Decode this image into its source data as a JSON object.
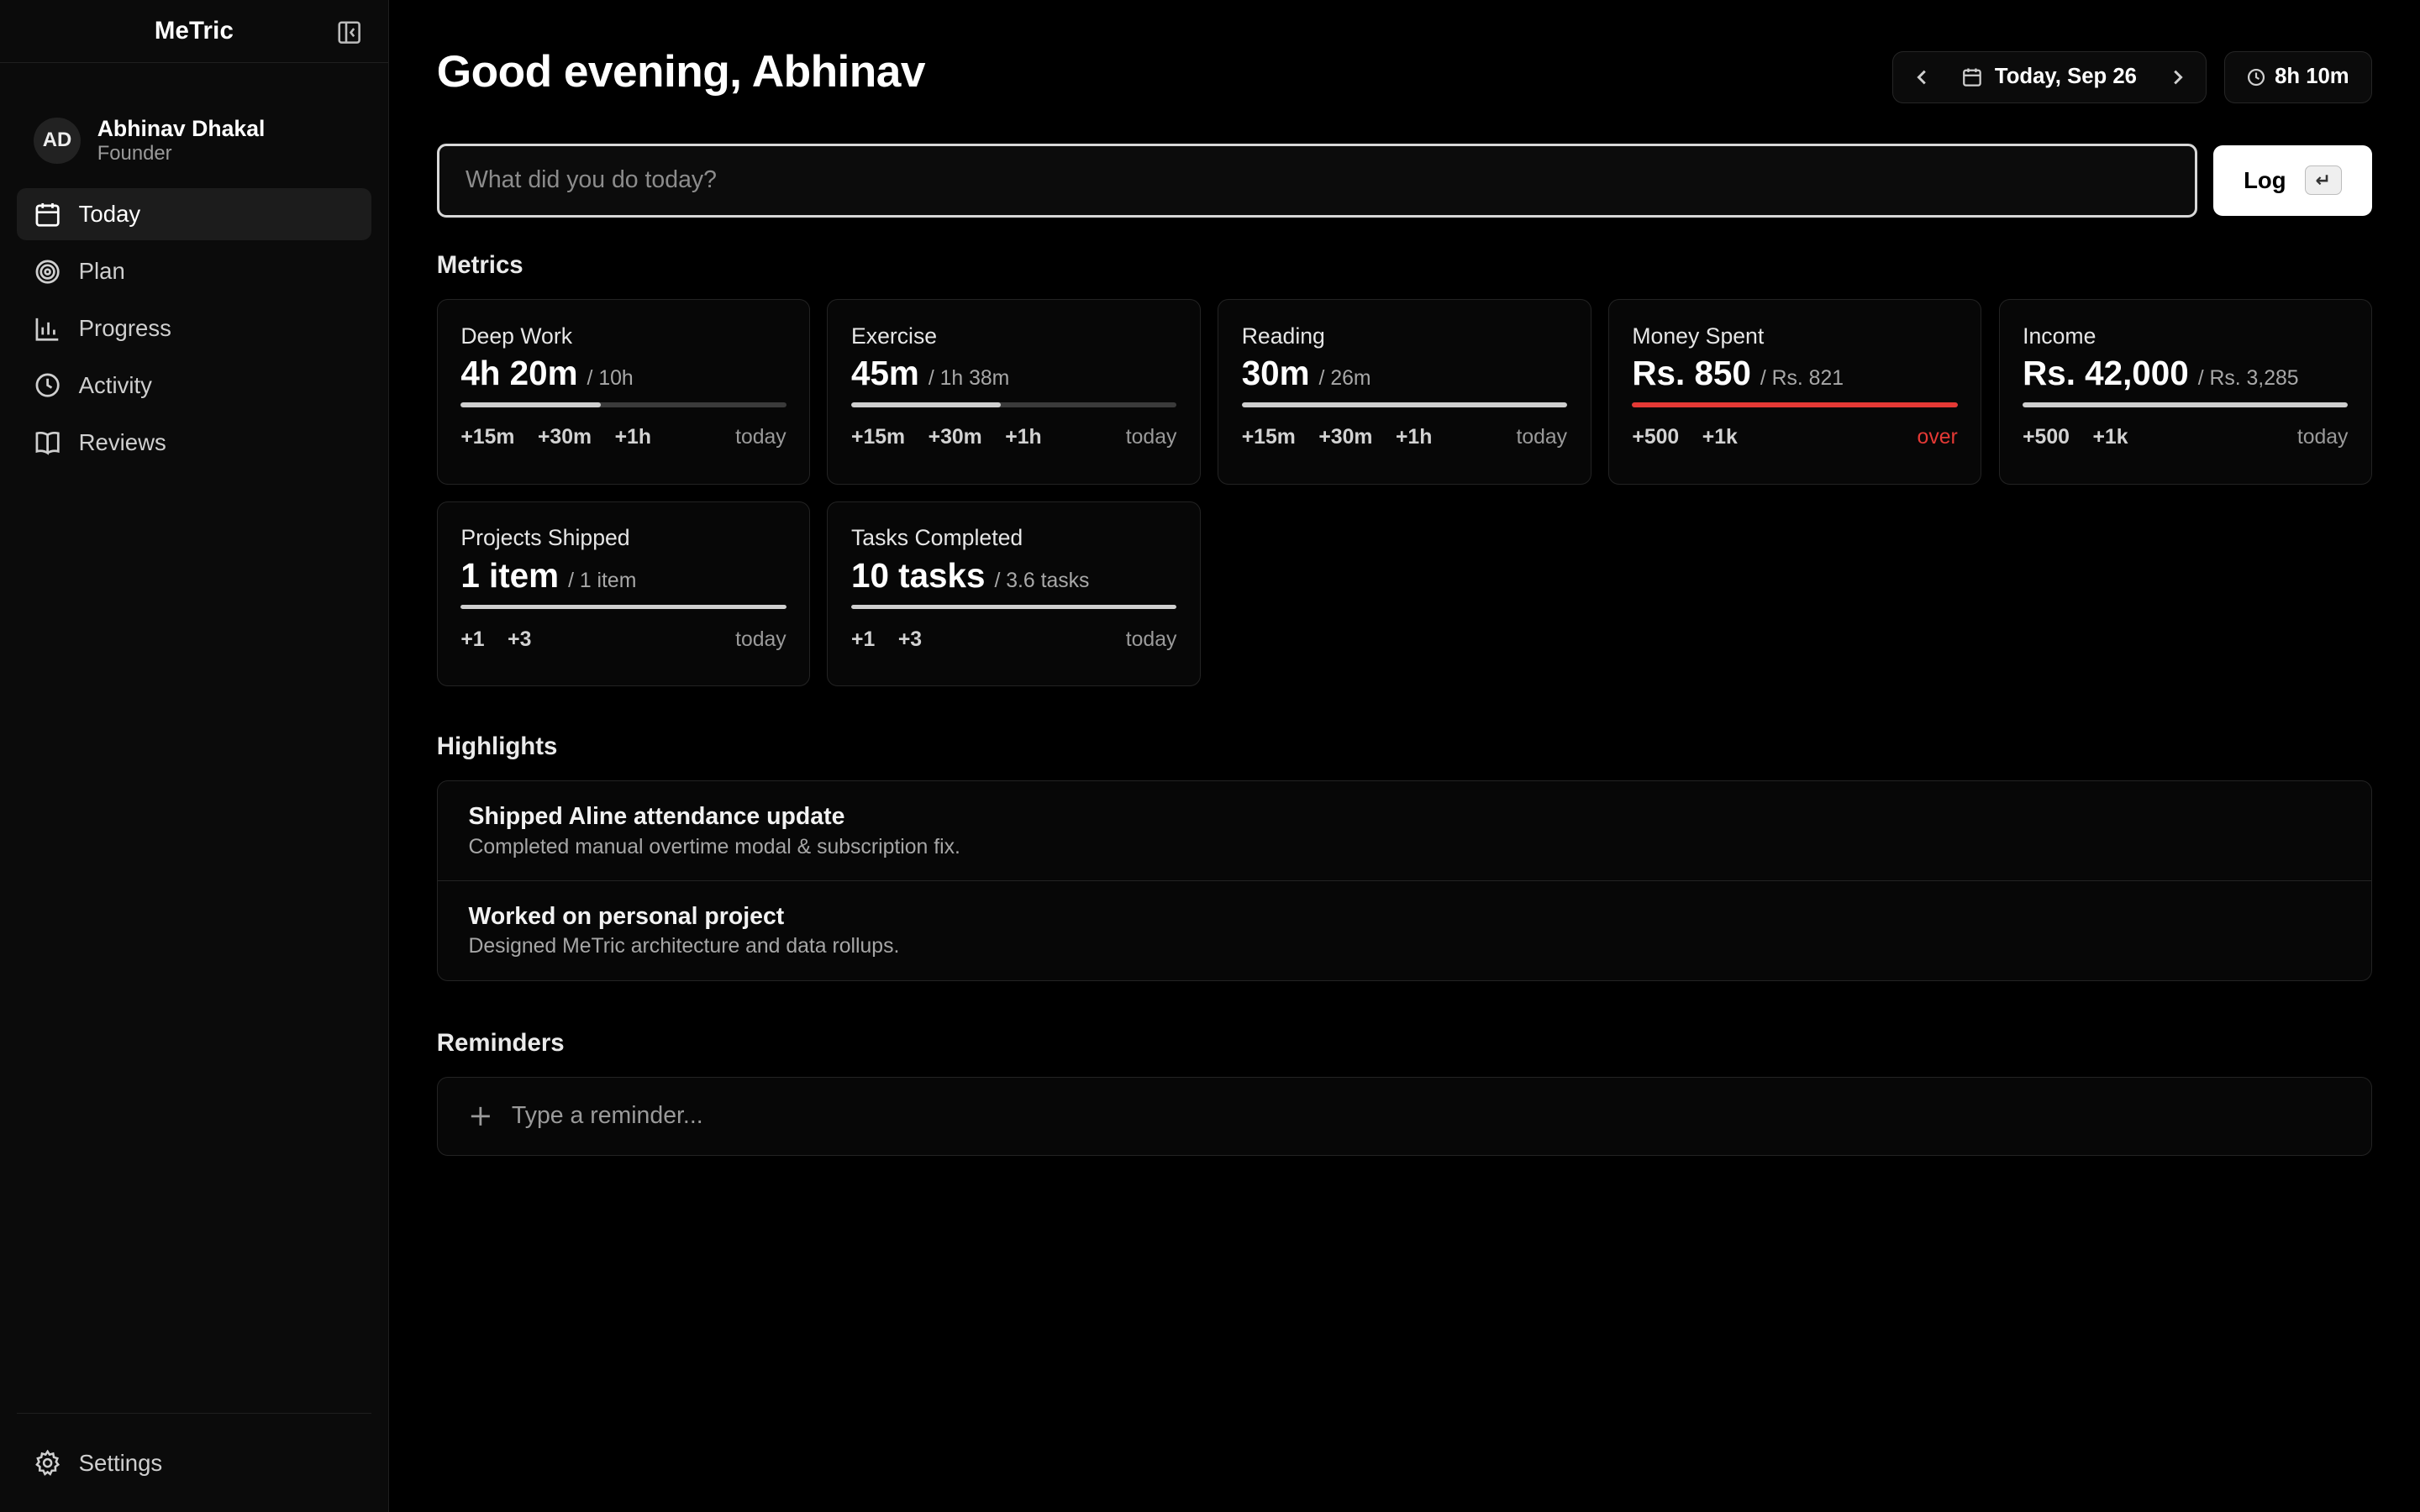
{
  "app": {
    "name": "MeTric"
  },
  "user": {
    "initials": "AD",
    "name": "Abhinav Dhakal",
    "role": "Founder"
  },
  "nav": [
    {
      "label": "Today",
      "icon": "calendar-icon",
      "active": true
    },
    {
      "label": "Plan",
      "icon": "target-icon",
      "active": false
    },
    {
      "label": "Progress",
      "icon": "bar-chart-icon",
      "active": false
    },
    {
      "label": "Activity",
      "icon": "clock-icon",
      "active": false
    },
    {
      "label": "Reviews",
      "icon": "book-icon",
      "active": false
    }
  ],
  "settings": {
    "label": "Settings",
    "icon": "gear-icon"
  },
  "header": {
    "greeting": "Good evening, Abhinav",
    "date_label": "Today, Sep 26",
    "time_total": "8h 10m"
  },
  "log": {
    "placeholder": "What did you do today?",
    "button_label": "Log",
    "shortcut": "↵"
  },
  "sections": {
    "metrics": "Metrics",
    "highlights": "Highlights",
    "reminders": "Reminders"
  },
  "metrics": [
    {
      "name": "Deep Work",
      "value": "4h 20m",
      "target": "/ 10h",
      "progress": 0.43,
      "over": false,
      "increments": [
        "+15m",
        "+30m",
        "+1h"
      ],
      "status": "today"
    },
    {
      "name": "Exercise",
      "value": "45m",
      "target": "/ 1h 38m",
      "progress": 0.46,
      "over": false,
      "increments": [
        "+15m",
        "+30m",
        "+1h"
      ],
      "status": "today"
    },
    {
      "name": "Reading",
      "value": "30m",
      "target": "/ 26m",
      "progress": 1.0,
      "over": false,
      "increments": [
        "+15m",
        "+30m",
        "+1h"
      ],
      "status": "today"
    },
    {
      "name": "Money Spent",
      "value": "Rs. 850",
      "target": "/ Rs. 821",
      "progress": 1.0,
      "over": true,
      "increments": [
        "+500",
        "+1k"
      ],
      "status": "over"
    },
    {
      "name": "Income",
      "value": "Rs. 42,000",
      "target": "/ Rs. 3,285",
      "progress": 1.0,
      "over": false,
      "increments": [
        "+500",
        "+1k"
      ],
      "status": "today"
    },
    {
      "name": "Projects Shipped",
      "value": "1 item",
      "target": "/ 1 item",
      "progress": 1.0,
      "over": false,
      "increments": [
        "+1",
        "+3"
      ],
      "status": "today"
    },
    {
      "name": "Tasks Completed",
      "value": "10 tasks",
      "target": "/ 3.6 tasks",
      "progress": 1.0,
      "over": false,
      "increments": [
        "+1",
        "+3"
      ],
      "status": "today"
    }
  ],
  "highlights": [
    {
      "title": "Shipped Aline attendance update",
      "desc": "Completed manual overtime modal & subscription fix."
    },
    {
      "title": "Worked on personal project",
      "desc": "Designed MeTric architecture and data rollups."
    }
  ],
  "reminders": {
    "placeholder": "Type a reminder..."
  },
  "colors": {
    "accent_over": "#e53935",
    "background": "#000000",
    "sidebar": "#0b0b0b"
  }
}
